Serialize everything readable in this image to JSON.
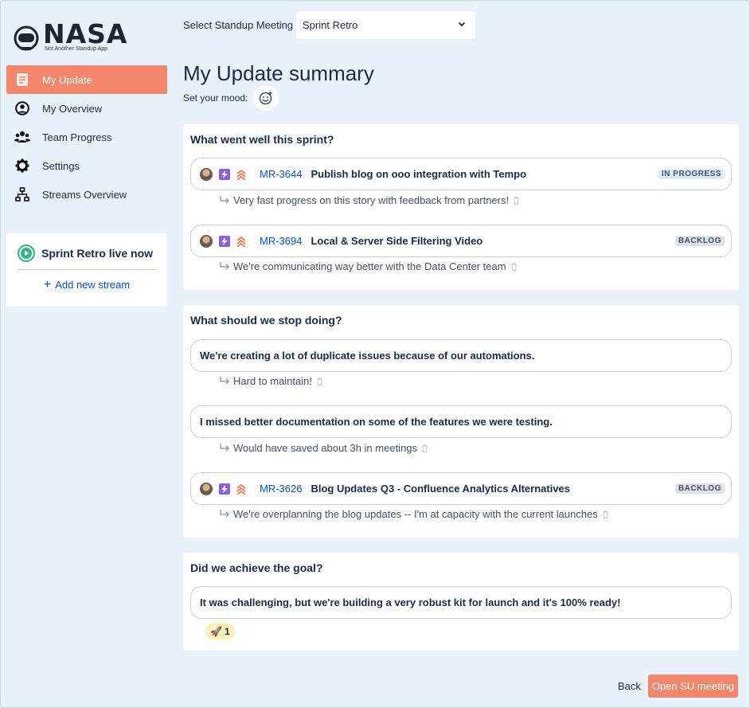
{
  "app": {
    "logo_text": "NASA",
    "logo_subtitle": "Not Another Standup App"
  },
  "sidebar": {
    "items": [
      {
        "label": "My Update",
        "icon": "document-icon",
        "active": true
      },
      {
        "label": "My Overview",
        "icon": "user-circle-icon",
        "active": false
      },
      {
        "label": "Team Progress",
        "icon": "team-icon",
        "active": false
      },
      {
        "label": "Settings",
        "icon": "gear-icon",
        "active": false
      },
      {
        "label": "Streams Overview",
        "icon": "hierarchy-icon",
        "active": false
      }
    ],
    "live": {
      "title": "Sprint Retro live now",
      "add_label": "Add new stream"
    }
  },
  "header": {
    "select_label": "Select Standup Meeting",
    "selected_meeting": "Sprint Retro",
    "title": "My Update summary",
    "mood_label": "Set your mood:"
  },
  "sections": [
    {
      "title": "What went well this sprint?",
      "items": [
        {
          "key": "MR-3644",
          "title": "Publish blog on ooo integration with Tempo",
          "status": "IN PROGRESS",
          "comment": "Very fast progress on this story with feedback from partners!"
        },
        {
          "key": "MR-3694",
          "title": "Local & Server Side Filtering Video",
          "status": "BACKLOG",
          "comment": "We're communicating way better with the Data Center team"
        }
      ]
    },
    {
      "title": "What should we stop doing?",
      "items": [
        {
          "text": "We're creating a lot of duplicate issues because of our automations.",
          "comment": "Hard to maintain!"
        },
        {
          "text": "I missed better documentation on some of the features we were testing.",
          "comment": "Would have saved about 3h in meetings"
        },
        {
          "key": "MR-3626",
          "title": "Blog Updates Q3 - Confluence Analytics Alternatives",
          "status": "BACKLOG",
          "comment": "We're overplanning the blog updates -- I'm at capacity with the current launches"
        }
      ]
    },
    {
      "title": "Did we achieve the goal?",
      "items": [
        {
          "text": "It was challenging, but we're building a very robust kit for launch and it's 100% ready!",
          "reaction_emoji": "🚀",
          "reaction_count": "1"
        }
      ]
    }
  ],
  "footer": {
    "back_label": "Back",
    "open_label": "Open SU meeting"
  },
  "colors": {
    "accent": "#f4876b",
    "background": "#e9f2fb",
    "link": "#0052cc",
    "live_green": "#36b37e",
    "epic_purple": "#8e5be3",
    "priority_orange": "#ff7452"
  }
}
